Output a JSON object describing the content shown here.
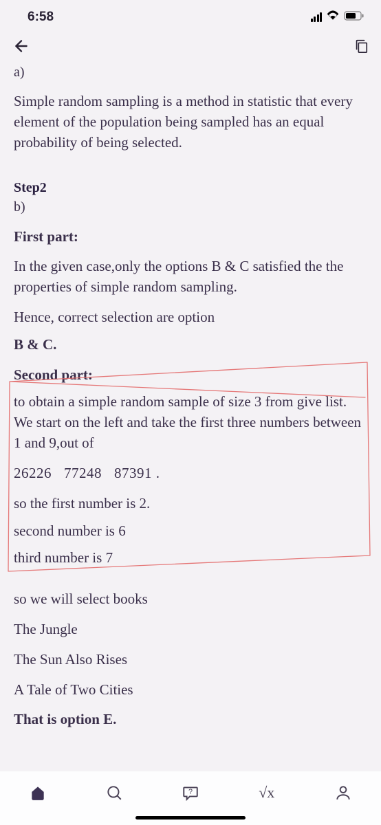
{
  "status": {
    "time": "6:58"
  },
  "content": {
    "label_a": "a)",
    "para_a": "Simple random sampling is a method in statistic  that every element of the population being sampled has an equal  probability of being selected.",
    "step2": "Step2",
    "label_b": "b)",
    "first_part_label": "First part:",
    "first_part_text": "In the given case,only the options B & C satisfied the the properties of simple random sampling.",
    "hence_text": "Hence, correct selection are option",
    "bc": "B & C.",
    "second_part_label": "Second part:",
    "second_part_text": "to obtain a simple random sample of size 3 from give list. We start on the left and take the first three numbers between 1 and 9,out of",
    "num1": "26226",
    "num2": "77248",
    "num3": "87391  .",
    "first_num": "so the first number is  2.",
    "second_num": "second number is 6",
    "third_num": "third number is 7",
    "so_select": "so we will select books",
    "book1": "The Jungle",
    "book2": "The Sun Also Rises",
    "book3": "A Tale of Two Cities",
    "option_e": "That is option E."
  },
  "math_symbol": "√x"
}
